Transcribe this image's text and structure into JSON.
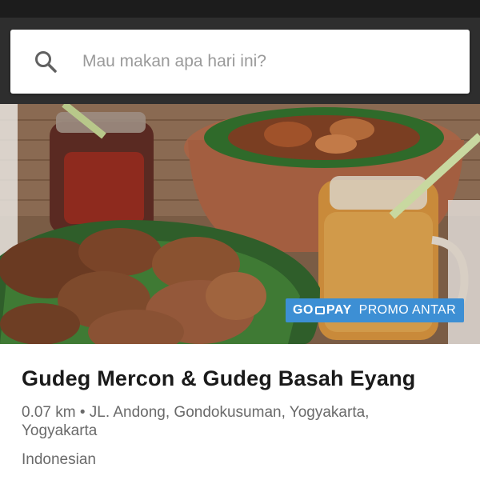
{
  "search": {
    "placeholder": "Mau makan apa hari ini?",
    "icon": "search-icon"
  },
  "promo": {
    "brand_left": "GO",
    "brand_right": "PAY",
    "label": "PROMO ANTAR",
    "color": "#3d8fd4"
  },
  "restaurant": {
    "name": "Gudeg Mercon & Gudeg Basah Eyang",
    "address_line1": "0.07 km • JL. Andong, Gondokusuman, Yogyakarta,",
    "address_line2": "Yogyakarta",
    "cuisine": "Indonesian"
  }
}
